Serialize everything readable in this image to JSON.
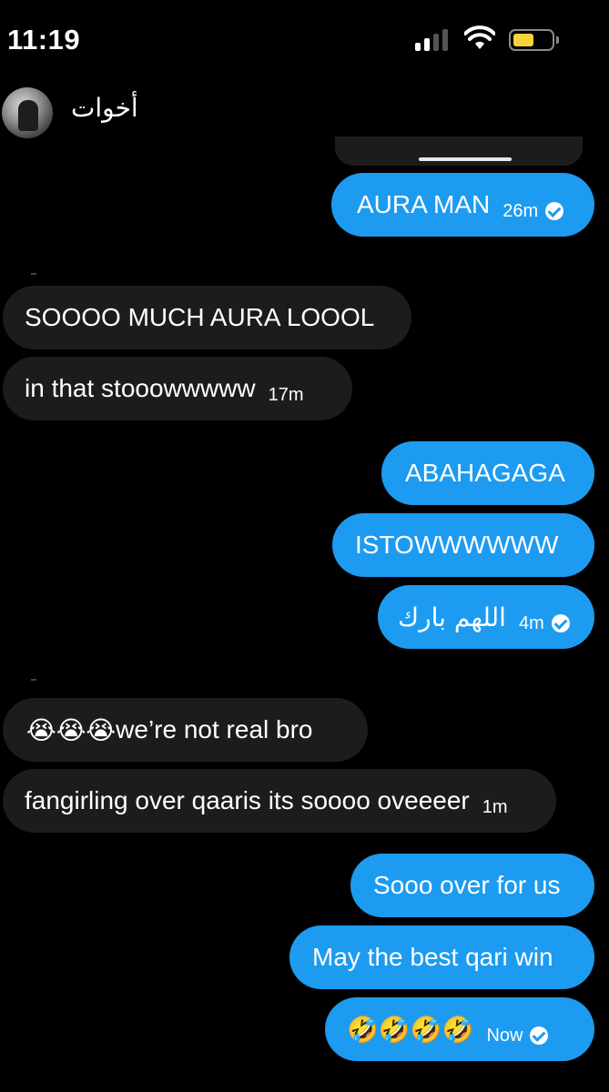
{
  "status_bar": {
    "time": "11:19",
    "battery_color": "#f7d23e"
  },
  "header": {
    "chat_name": "أخوات"
  },
  "colors": {
    "outgoing_bubble": "#1d9bf0",
    "incoming_bubble": "#1c1c1e",
    "background": "#000000"
  },
  "messages": [
    {
      "direction": "outgoing",
      "text": "AURA MAN",
      "time": "26m",
      "read": true
    },
    {
      "direction": "incoming",
      "text": "SOOOO MUCH AURA LOOOL"
    },
    {
      "direction": "incoming",
      "text": "in that stooowwwww",
      "time": "17m"
    },
    {
      "direction": "outgoing",
      "text": "ABAHAGAGA"
    },
    {
      "direction": "outgoing",
      "text": "ISTOWWWWWW"
    },
    {
      "direction": "outgoing",
      "text": "اللهم بارك",
      "time": "4m",
      "read": true
    },
    {
      "direction": "incoming",
      "emoji": "😭😭😭",
      "text": "we’re not real bro"
    },
    {
      "direction": "incoming",
      "text": "fangirling over qaaris its soooo oveeeer",
      "time": "1m"
    },
    {
      "direction": "outgoing",
      "text": "Sooo over for us"
    },
    {
      "direction": "outgoing",
      "text": "May the best qari win"
    },
    {
      "direction": "outgoing",
      "emoji": "🤣🤣🤣🤣",
      "time": "Now",
      "read": true
    }
  ]
}
